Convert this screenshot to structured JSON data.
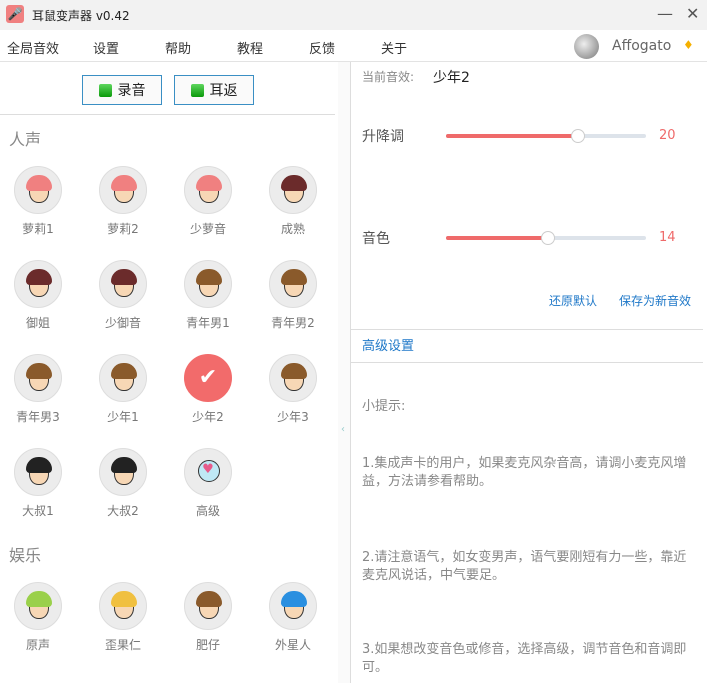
{
  "window": {
    "title": "耳鼠变声器 v0.42",
    "minimize": "—",
    "close": "✕"
  },
  "menu": [
    "全局音效",
    "设置",
    "帮助",
    "教程",
    "反馈",
    "关于"
  ],
  "user": {
    "name": "Affogato",
    "badge": "♦"
  },
  "controls": {
    "record": "录音",
    "monitor": "耳返"
  },
  "sections": {
    "human": "人声",
    "fun": "娱乐"
  },
  "human_voices": [
    {
      "label": "萝莉1",
      "hair": "#f08080"
    },
    {
      "label": "萝莉2",
      "hair": "#f08080"
    },
    {
      "label": "少萝音",
      "hair": "#f08080"
    },
    {
      "label": "成熟",
      "hair": "#6b2b2b"
    },
    {
      "label": "御姐",
      "hair": "#6b2b2b"
    },
    {
      "label": "少御音",
      "hair": "#6b2b2b"
    },
    {
      "label": "青年男1",
      "hair": "#8a5a2b"
    },
    {
      "label": "青年男2",
      "hair": "#8a5a2b"
    },
    {
      "label": "青年男3",
      "hair": "#8a5a2b"
    },
    {
      "label": "少年1",
      "hair": "#8a5a2b"
    },
    {
      "label": "少年2",
      "hair": "#8a5a2b",
      "selected": true
    },
    {
      "label": "少年3",
      "hair": "#8a5a2b"
    },
    {
      "label": "大叔1",
      "hair": "#222222"
    },
    {
      "label": "大叔2",
      "hair": "#222222"
    },
    {
      "label": "高级",
      "hair": "none"
    }
  ],
  "fun_voices": [
    {
      "label": "原声",
      "hair": "#9ad04a"
    },
    {
      "label": "歪果仁",
      "hair": "#f0c040"
    },
    {
      "label": "肥仔",
      "hair": "#8a5a2b"
    },
    {
      "label": "外星人",
      "hair": "#2a8fe0"
    }
  ],
  "right": {
    "current_label": "当前音效:",
    "current_value": "少年2",
    "pitch_label": "升降调",
    "pitch_value": "20",
    "pitch_fraction": 0.66,
    "timbre_label": "音色",
    "timbre_value": "14",
    "timbre_fraction": 0.51,
    "reset": "还原默认",
    "save": "保存为新音效",
    "advanced": "高级设置",
    "tips_title": "小提示:",
    "tips": [
      "1.集成声卡的用户，如果麦克风杂音高，请调小麦克风增益，方法请参看帮助。",
      "2.请注意语气，如女变男声，语气要刚短有力一些，靠近麦克风说话，中气要足。",
      "3.如果想改变音色或修音，选择高级，调节音色和音调即可。"
    ]
  },
  "colors": {
    "accent": "#ef6a6a",
    "link": "#1f78c8",
    "button_border": "#3a8fc4"
  }
}
